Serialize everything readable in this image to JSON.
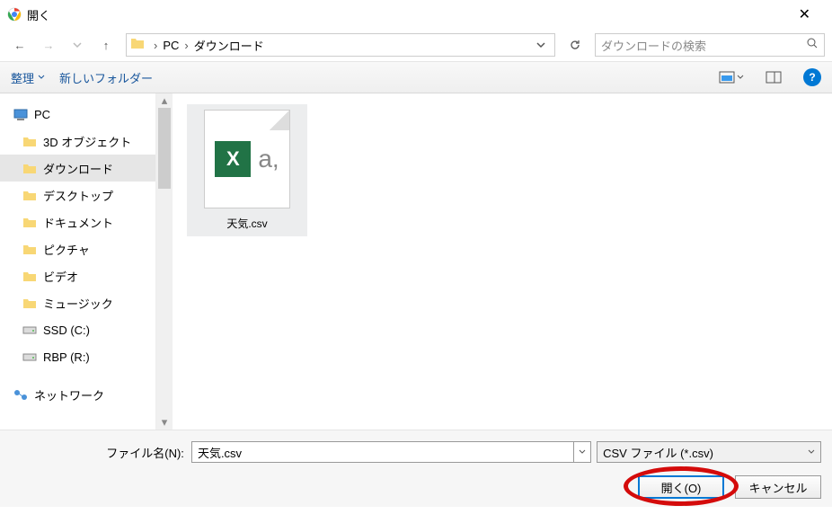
{
  "title": "開く",
  "breadcrumb": {
    "pc": "PC",
    "downloads": "ダウンロード"
  },
  "search": {
    "placeholder": "ダウンロードの検索"
  },
  "toolbar": {
    "organize": "整理",
    "new_folder": "新しいフォルダー"
  },
  "tree": {
    "pc": "PC",
    "items": [
      "3D オブジェクト",
      "ダウンロード",
      "デスクトップ",
      "ドキュメント",
      "ピクチャ",
      "ビデオ",
      "ミュージック",
      "SSD (C:)",
      "RBP (R:)"
    ],
    "network": "ネットワーク"
  },
  "file": {
    "name": "天気.csv"
  },
  "footer": {
    "filename_label": "ファイル名(N):",
    "filename_value": "天気.csv",
    "filetype": "CSV ファイル (*.csv)",
    "open": "開く(O)",
    "cancel": "キャンセル"
  }
}
